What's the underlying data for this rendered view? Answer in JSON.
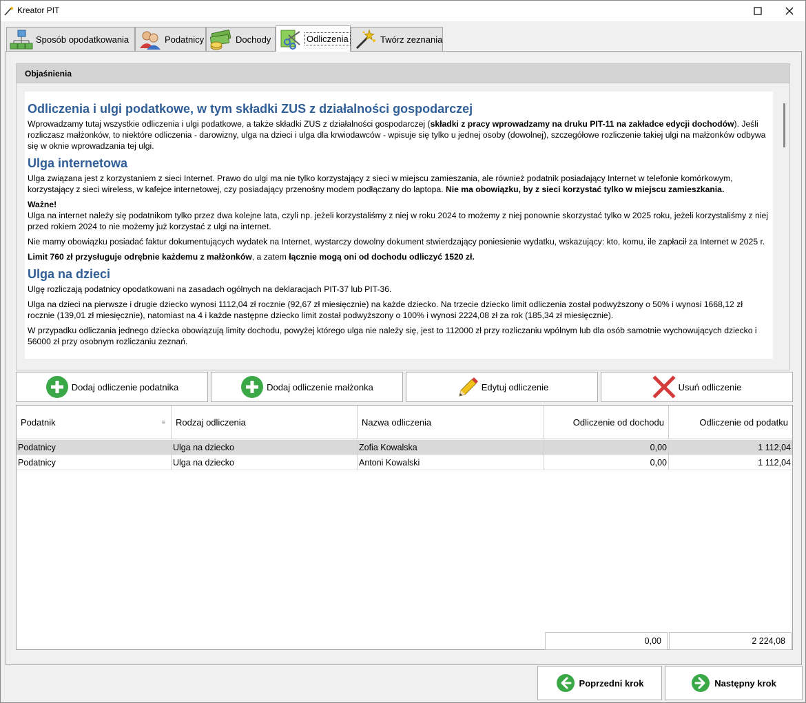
{
  "window": {
    "title": "Kreator PIT"
  },
  "tabs": [
    {
      "label": "Sposób opodatkowania",
      "icon": "network-icon"
    },
    {
      "label": "Podatnicy",
      "icon": "users-icon"
    },
    {
      "label": "Dochody",
      "icon": "money-icon"
    },
    {
      "label": "Odliczenia",
      "icon": "scissors-icon",
      "active": true
    },
    {
      "label": "Twórz zeznania",
      "icon": "magic-wand-icon"
    }
  ],
  "explanations": {
    "header": "Objaśnienia",
    "s1": {
      "title": "Odliczenia i ulgi podatkowe, w tym składki ZUS z działalności gospodarczej",
      "p1_a": "Wprowadzamy tutaj wszystkie odliczenia i ulgi podatkowe, a także składki ZUS z działalności gospodarczej (",
      "p1_b": "składki z pracy wprowadzamy na druku PIT-11 na zakładce edycji dochodów",
      "p1_c": "). Jeśli rozliczasz małżonków, to niektóre odliczenia - darowizny, ulga na dzieci i ulga dla krwiodawców - wpisuje się tylko u jednej osoby (dowolnej), szczegółowe rozliczenie takiej ulgi na małżonków odbywa się w oknie wprowadzania tej ulgi."
    },
    "s2": {
      "title": "Ulga internetowa",
      "p1_a": "Ulga związana jest z korzystaniem z sieci Internet. Prawo do ulgi ma nie tylko korzystający z sieci w miejscu zamieszania, ale również podatnik posiadający Internet w telefonie komórkowym, korzystający z sieci wireless, w kafejce internetowej, czy posiadający przenośny modem podłączany do laptopa. ",
      "p1_b": "Nie ma obowiązku, by z sieci korzystać tylko w miejscu zamieszkania.",
      "important": "Ważne!",
      "p2": "Ulga na internet należy się podatnikom tylko przez dwa kolejne lata, czyli np. jeżeli korzystaliśmy z niej w roku 2024 to możemy z niej ponownie skorzystać tylko w 2025 roku, jeżeli korzystaliśmy z niej przed rokiem 2024 to nie możemy już korzystać z ulgi na internet.",
      "p3": "Nie mamy obowiązku posiadać faktur dokumentujących wydatek na Internet, wystarczy dowolny dokument stwierdzający poniesienie wydatku, wskazujący: kto, komu, ile zapłacił za Internet w 2025 r.",
      "p4_a": "Limit 760 zł przysługuje odrębnie każdemu z małżonków",
      "p4_b": ", a zatem ",
      "p4_c": "łącznie mogą oni od dochodu odliczyć 1520 zł."
    },
    "s3": {
      "title": "Ulga na dzieci",
      "p1": "Ulgę rozliczają podatnicy opodatkowani na zasadach ogólnych na deklaracjach PIT-37 lub PIT-36.",
      "p2": "Ulga na dzieci na pierwsze i drugie dziecko wynosi 1112,04 zł rocznie (92,67 zł miesięcznie) na każde dziecko. Na trzecie dziecko limit odliczenia został podwyższony o 50% i wynosi 1668,12 zł rocznie (139,01 zł miesięcznie), natomiast na 4 i każde następne dziecko limit został podwyższony o 100% i wynosi 2224,08 zł za rok (185,34 zł miesięcznie).",
      "p3": "W przypadku odliczania jednego dziecka obowiązują limity dochodu, powyżej którego ulga nie należy się, jest to 112000 zł przy rozliczaniu wpólnym lub dla osób samotnie wychowujących dziecko i 56000 zł przy osobnym rozliczaniu zeznań."
    }
  },
  "actions": {
    "add_taxpayer": "Dodaj odliczenie podatnika",
    "add_spouse": "Dodaj odliczenie małżonka",
    "edit": "Edytuj odliczenie",
    "delete": "Usuń odliczenie"
  },
  "table": {
    "headers": {
      "taxpayer": "Podatnik",
      "type": "Rodzaj odliczenia",
      "name": "Nazwa odliczenia",
      "from_income": "Odliczenie od dochodu",
      "from_tax": "Odliczenie od podatku"
    },
    "rows": [
      {
        "taxpayer": "Podatnicy",
        "type": "Ulga na dziecko",
        "name": "Zofia Kowalska",
        "from_income": "0,00",
        "from_tax": "1 112,04"
      },
      {
        "taxpayer": "Podatnicy",
        "type": "Ulga na dziecko",
        "name": "Antoni Kowalski",
        "from_income": "0,00",
        "from_tax": "1 112,04"
      }
    ],
    "totals": {
      "from_income": "0,00",
      "from_tax": "2 224,08"
    }
  },
  "nav": {
    "prev": "Poprzedni krok",
    "next": "Następny krok"
  },
  "colors": {
    "heading": "#2f5e97",
    "green": "#3aa847",
    "red": "#d43c3c"
  }
}
